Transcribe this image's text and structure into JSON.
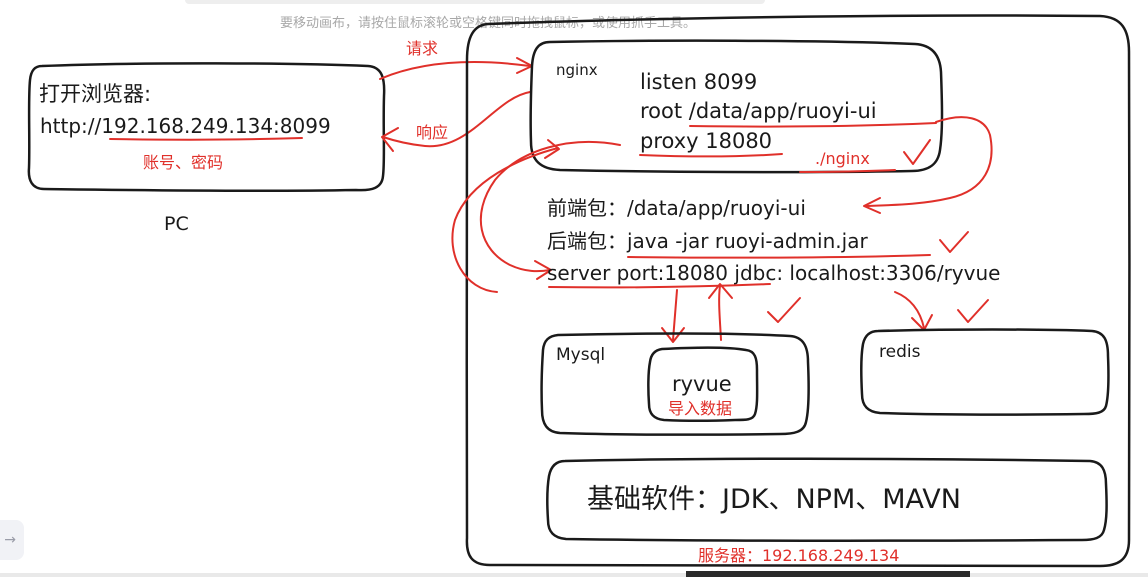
{
  "canvas_hint": "要移动画布，请按住鼠标滚轮或空格键同时拖拽鼠标，或使用抓手工具。",
  "pc": {
    "line1": "打开浏览器:",
    "line2": "http://192.168.249.134:8099",
    "note": "账号、密码",
    "label": "PC"
  },
  "arrows": {
    "request": "请求",
    "response": "响应"
  },
  "nginx": {
    "title": "nginx",
    "listen": "listen 8099",
    "root": "root /data/app/ruoyi-ui",
    "proxy": "proxy 18080",
    "note": "./nginx"
  },
  "server_info": {
    "frontend": "前端包：/data/app/ruoyi-ui",
    "backend": "后端包：java -jar ruoyi-admin.jar",
    "config": "server port:18080   jdbc: localhost:3306/ryvue"
  },
  "mysql": {
    "title": "Mysql",
    "db": "ryvue",
    "note": "导入数据"
  },
  "redis": {
    "title": "redis"
  },
  "base": {
    "label": "基础软件：JDK、NPM、MAVN"
  },
  "server_label": "服务器：192.168.249.134",
  "side_button_icon": "→",
  "colors": {
    "ink": "#1a1a1a",
    "annotation": "#e0302a",
    "hint": "#a8a8a8"
  }
}
